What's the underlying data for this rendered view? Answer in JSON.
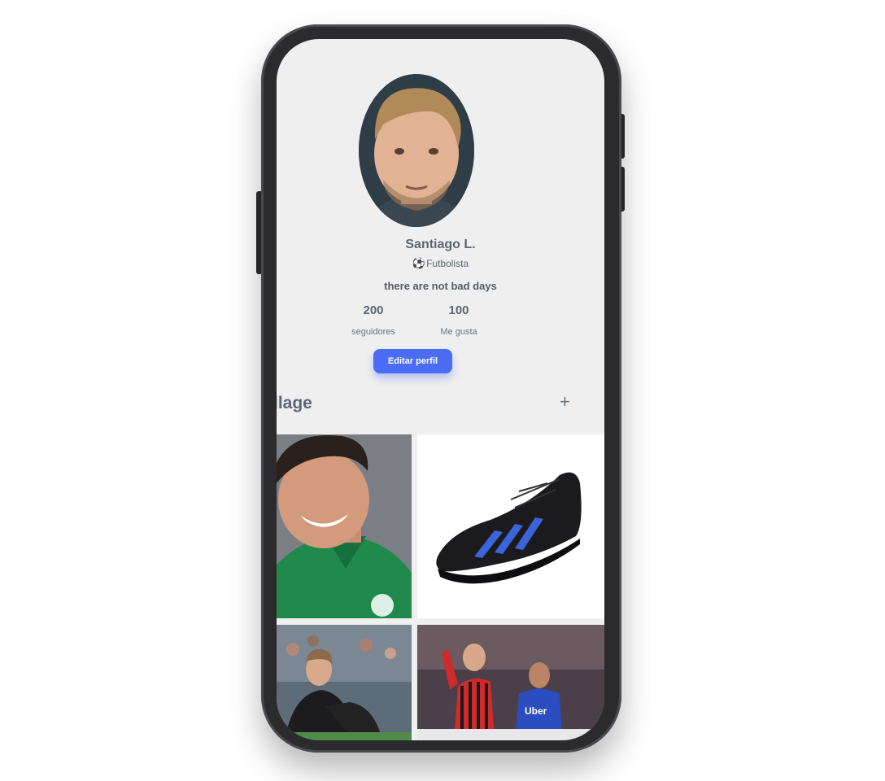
{
  "profile": {
    "name": "Santiago L.",
    "role_icon": "soccer-ball-icon",
    "role": "Futbolista",
    "bio": "there are not bad days",
    "stats": [
      {
        "value": "200",
        "label": "seguidores"
      },
      {
        "value": "100",
        "label": "Me gusta"
      }
    ],
    "edit_button": "Editar perfil"
  },
  "gallery": {
    "title": "llage",
    "add_icon": "plus-icon"
  },
  "colors": {
    "accent": "#4a6cf7",
    "text": "#5b6674",
    "screen_bg": "#efefef"
  }
}
